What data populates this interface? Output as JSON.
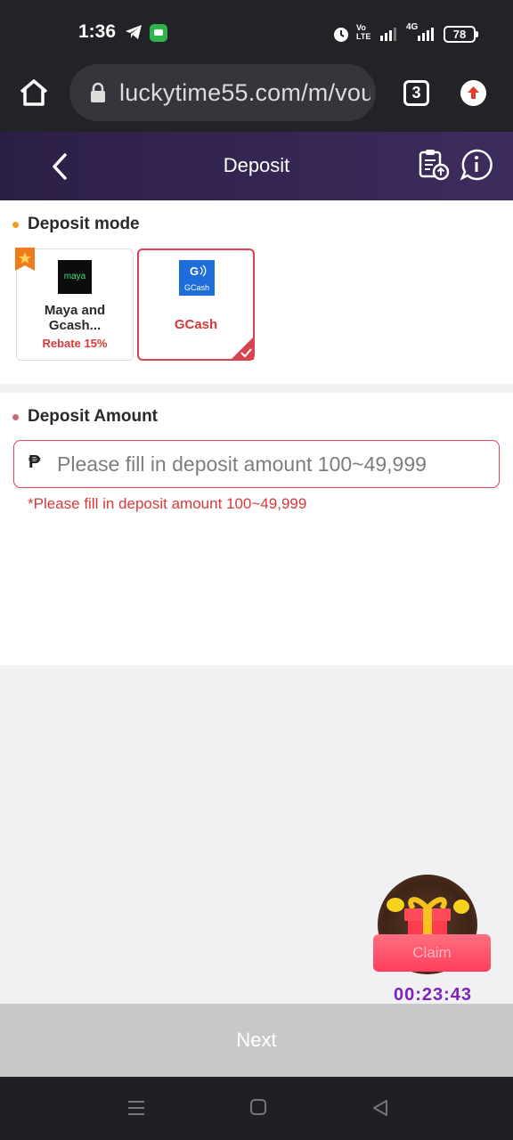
{
  "status_bar": {
    "time": "1:36",
    "volte": "Vo LTE",
    "network": "4G",
    "battery": "78"
  },
  "browser": {
    "url": "luckytime55.com/m/vou",
    "tab_count": "3"
  },
  "header": {
    "title": "Deposit"
  },
  "deposit_mode": {
    "title": "Deposit mode",
    "methods": [
      {
        "logo_text": "maya",
        "name": "Maya and Gcash...",
        "rebate": "Rebate 15%",
        "selected": false
      },
      {
        "logo_text": "GCash",
        "name": "GCash",
        "selected": true
      }
    ]
  },
  "deposit_amount": {
    "title": "Deposit Amount",
    "currency_symbol": "₱",
    "placeholder": "Please fill in deposit amount 100~49,999",
    "hint": "*Please fill in deposit amount 100~49,999"
  },
  "gift_widget": {
    "claim_label": "Claim",
    "countdown": "00:23:43"
  },
  "footer": {
    "next_label": "Next"
  },
  "colors": {
    "accent_red": "#d7434e",
    "header_purple": "#2c1f45",
    "countdown_purple": "#7e22b8"
  }
}
